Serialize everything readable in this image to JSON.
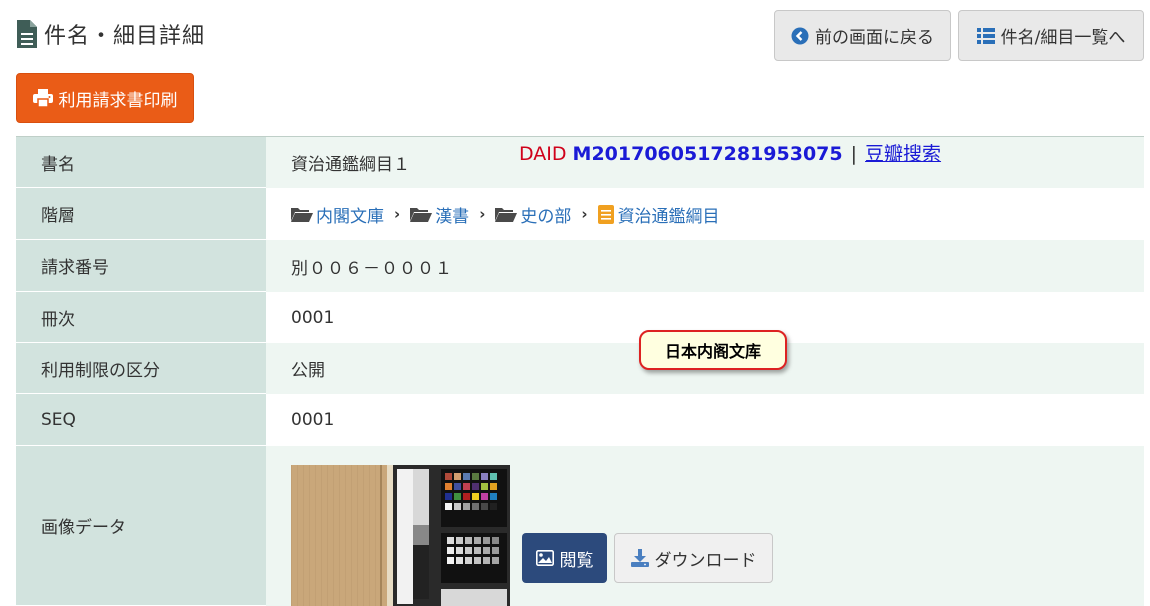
{
  "header": {
    "title": "件名・細目詳細",
    "back_label": "前の画面に戻る",
    "list_label": "件名/細目一覧へ"
  },
  "print_label": "利用請求書印刷",
  "daid": {
    "label": "DAID",
    "value": "M2017060517281953075",
    "separator": "|",
    "link": "豆瓣搜索"
  },
  "rows": {
    "title": {
      "label": "書名",
      "value": "資治通鑑綱目１"
    },
    "hierarchy": {
      "label": "階層",
      "items": [
        "内閣文庫",
        "漢書",
        "史の部",
        "資治通鑑綱目"
      ]
    },
    "call_number": {
      "label": "請求番号",
      "value": "別００６－０００１"
    },
    "volume": {
      "label": "冊次",
      "value": "0001"
    },
    "access": {
      "label": "利用制限の区分",
      "value": "公開"
    },
    "seq": {
      "label": "SEQ",
      "value": "0001"
    },
    "image": {
      "label": "画像データ"
    }
  },
  "tooltip": "日本内阁文库",
  "image_actions": {
    "view_label": "閲覧",
    "download_label": "ダウンロード"
  },
  "colors": {
    "accent_orange": "#ea5c17",
    "view_button": "#2c4a7c",
    "label_bg": "#d2e3de",
    "row_bg": "#eef6f2",
    "daid_red": "#d0021b",
    "daid_blue": "#1a1ad6",
    "link_blue": "#2a6fb8"
  },
  "icons": {
    "title": "document-icon",
    "back": "chevron-left-circle-icon",
    "list": "list-icon",
    "print": "printer-icon",
    "folder": "folder-open-icon",
    "book": "book-icon",
    "view": "image-icon",
    "download": "download-icon"
  }
}
